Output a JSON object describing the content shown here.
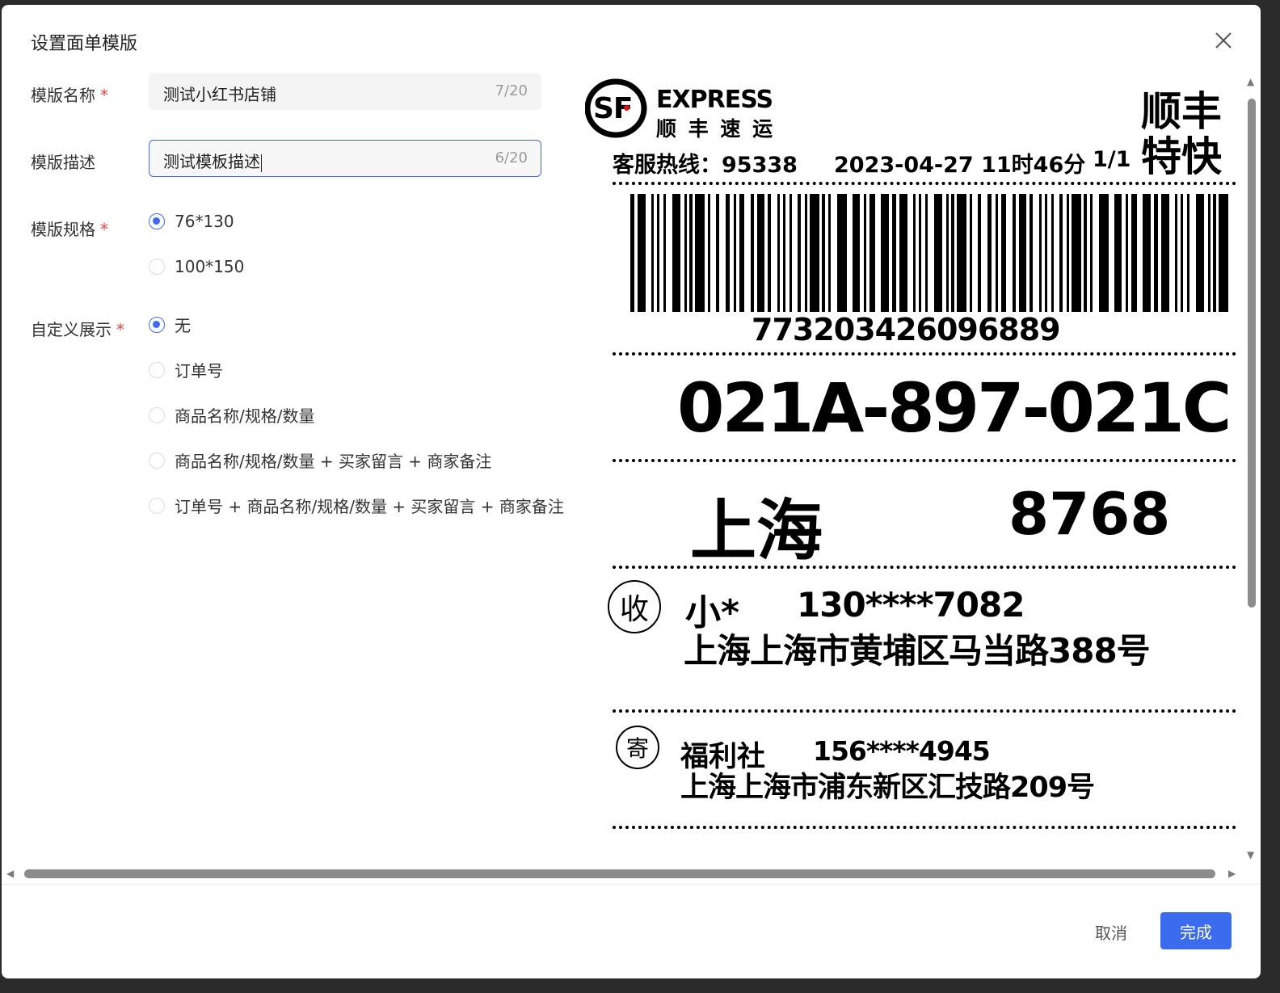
{
  "dialog": {
    "title": "设置面单模版",
    "close_icon": "close-icon"
  },
  "form": {
    "name": {
      "label": "模版名称",
      "required_mark": "*",
      "value": "测试小红书店铺",
      "count": "7/20"
    },
    "desc": {
      "label": "模版描述",
      "value": "测试模板描述",
      "count": "6/20"
    },
    "spec": {
      "label": "模版规格",
      "required_mark": "*",
      "options": [
        {
          "label": "76*130",
          "selected": true
        },
        {
          "label": "100*150",
          "selected": false
        }
      ]
    },
    "custom": {
      "label": "自定义展示",
      "required_mark": "*",
      "options": [
        {
          "label": "无",
          "selected": true
        },
        {
          "label": "订单号",
          "selected": false
        },
        {
          "label": "商品名称/规格/数量",
          "selected": false
        },
        {
          "label": "商品名称/规格/数量 + 买家留言 + 商家备注",
          "selected": false
        },
        {
          "label": "订单号 + 商品名称/规格/数量 + 买家留言 + 商家备注",
          "selected": false
        }
      ]
    }
  },
  "label_preview": {
    "logo_mark": "SF",
    "logo_en": "EXPRESS",
    "logo_cn": "顺 丰 速 运",
    "service_line1": "顺丰",
    "service_line2": "特快",
    "hotline": "客服热线：95338",
    "datetime": "2023-04-27 11时46分",
    "page": "1/1",
    "tracking_number": "773203426096889",
    "route_code": "021A-897-021C",
    "dest_city": "上海",
    "dest_code": "8768",
    "recipient_mark": "收",
    "recipient_name": "小*",
    "recipient_phone": "130****7082",
    "recipient_address": "上海上海市黄埔区马当路388号",
    "sender_mark": "寄",
    "sender_name": "福利社",
    "sender_phone": "156****4945",
    "sender_address": "上海上海市浦东新区汇技路209号"
  },
  "footer": {
    "cancel": "取消",
    "confirm": "完成"
  },
  "colors": {
    "primary": "#3b6cf0",
    "required": "#e54545"
  }
}
